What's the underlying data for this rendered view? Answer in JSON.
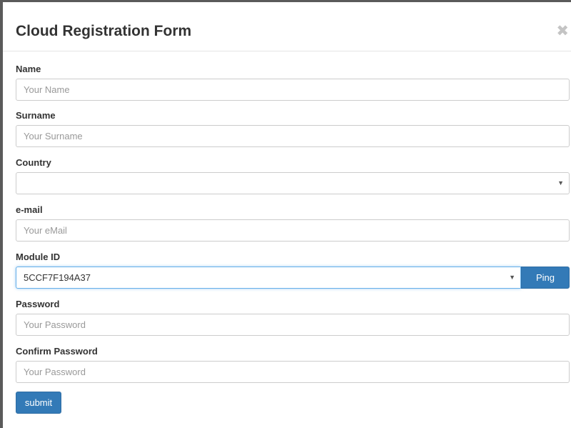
{
  "modal": {
    "title": "Cloud Registration Form",
    "close_glyph": "✖"
  },
  "form": {
    "name": {
      "label": "Name",
      "placeholder": "Your Name"
    },
    "surname": {
      "label": "Surname",
      "placeholder": "Your Surname"
    },
    "country": {
      "label": "Country",
      "value": "",
      "arrow": "▼"
    },
    "email": {
      "label": "e-mail",
      "placeholder": "Your eMail"
    },
    "module_id": {
      "label": "Module ID",
      "value": "5CCF7F194A37",
      "arrow": "▼",
      "ping_label": "Ping"
    },
    "password": {
      "label": "Password",
      "placeholder": "Your Password"
    },
    "confirm_password": {
      "label": "Confirm Password",
      "placeholder": "Your Password"
    },
    "submit_label": "submit"
  },
  "colors": {
    "primary": "#337ab7",
    "focus_border": "#66afe9",
    "frame": "#5a5a5a"
  }
}
